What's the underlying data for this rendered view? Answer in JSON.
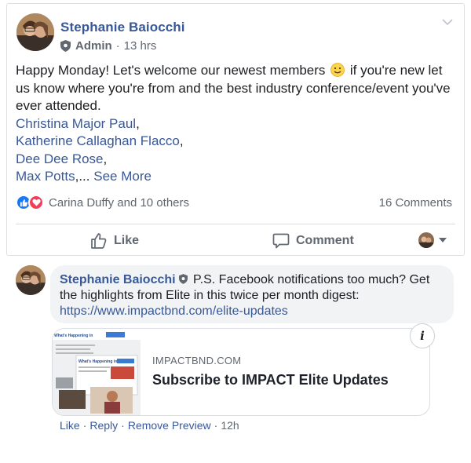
{
  "post": {
    "author": "Stephanie Baiocchi",
    "role": "Admin",
    "time": "13 hrs",
    "text_line1": "Happy Monday! Let's welcome our newest members",
    "text_after_emoji": " if you're new let us know where you're from and the best industry conference/event you've ever attended.",
    "mentions": [
      "Christina Major Paul",
      "Katherine Callaghan Flacco",
      "Dee Dee Rose",
      "Max Potts"
    ],
    "mention_separators": [
      ",",
      ",",
      ",",
      ",..."
    ],
    "see_more": "See More",
    "reactions_text": "Carina Duffy and 10 others",
    "comments_count": "16 Comments",
    "like_label": "Like",
    "comment_label": "Comment"
  },
  "comment": {
    "author": "Stephanie Baiocchi",
    "text": "P.S. Facebook notifications too much? Get the highlights from Elite in this twice per month digest:",
    "link": "https://www.impactbnd.com/elite-updates",
    "preview_domain": "IMPACTBND.COM",
    "preview_title": "Subscribe to IMPACT Elite Updates",
    "thumb_heading": "What's Happening in",
    "thumb_heading2": "What's Happening in",
    "info_label": "i",
    "actions": {
      "like": "Like",
      "reply": "Reply",
      "remove_preview": "Remove Preview",
      "time": "12h",
      "sep": "·"
    }
  },
  "colors": {
    "link": "#385898",
    "meta": "#616770",
    "like_blue": "#1877f2",
    "love_red": "#f33e58",
    "bubble": "#f2f3f5"
  }
}
